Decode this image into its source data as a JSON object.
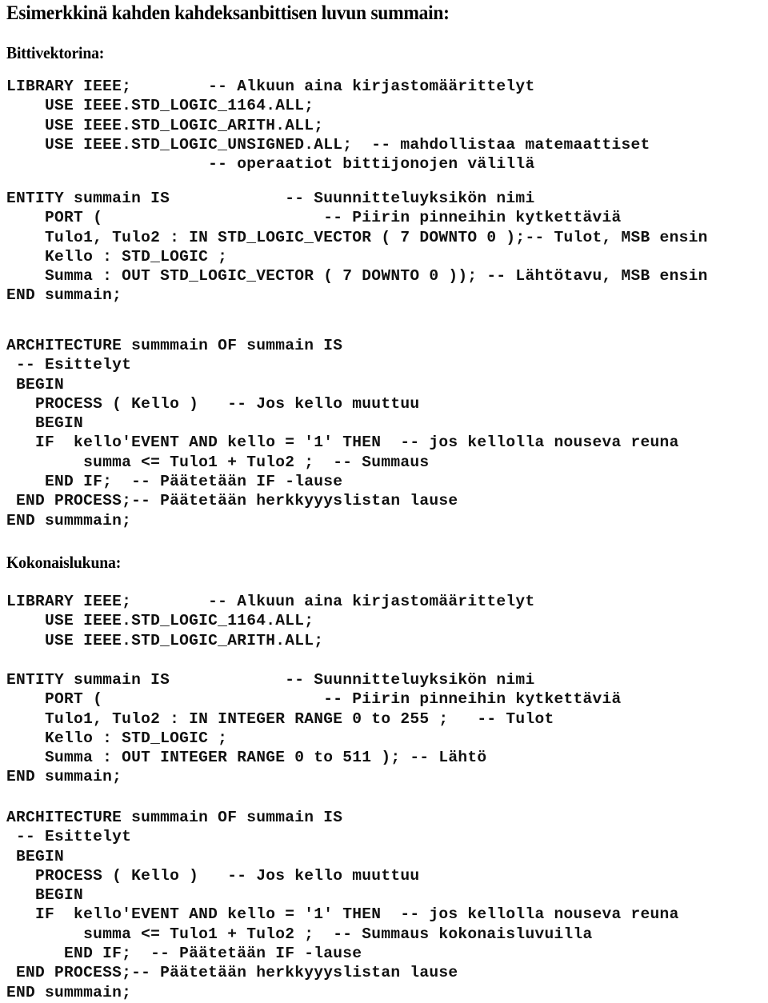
{
  "document": {
    "title": "Esimerkkinä kahden kahdeksanbittisen luvun summain:",
    "section_1_heading": "Bittivektorina:",
    "section_2_heading": "Kokonaislukuna:"
  },
  "code": {
    "block_1_library": "LIBRARY IEEE;        -- Alkuun aina kirjastomäärittelyt\n    USE IEEE.STD_LOGIC_1164.ALL;\n    USE IEEE.STD_LOGIC_ARITH.ALL;\n    USE IEEE.STD_LOGIC_UNSIGNED.ALL;  -- mahdollistaa matemaattiset\n                     -- operaatiot bittijonojen välillä",
    "block_2_entity": "ENTITY summain IS            -- Suunnitteluyksikön nimi\n    PORT (                       -- Piirin pinneihin kytkettäviä\n    Tulo1, Tulo2 : IN STD_LOGIC_VECTOR ( 7 DOWNTO 0 );-- Tulot, MSB ensin\n    Kello : STD_LOGIC ;\n    Summa : OUT STD_LOGIC_VECTOR ( 7 DOWNTO 0 )); -- Lähtötavu, MSB ensin\nEND summain;",
    "block_3_architecture": "ARCHITECTURE summmain OF summain IS\n -- Esittelyt\n BEGIN\n   PROCESS ( Kello )   -- Jos kello muuttuu\n   BEGIN\n   IF  kello'EVENT AND kello = '1' THEN  -- jos kellolla nouseva reuna\n        summa <= Tulo1 + Tulo2 ;  -- Summaus\n    END IF;  -- Päätetään IF -lause\n END PROCESS;-- Päätetään herkkyyyslistan lause\nEND summmain;",
    "block_4_library": "LIBRARY IEEE;        -- Alkuun aina kirjastomäärittelyt\n    USE IEEE.STD_LOGIC_1164.ALL;\n    USE IEEE.STD_LOGIC_ARITH.ALL;",
    "block_5_entity": "ENTITY summain IS            -- Suunnitteluyksikön nimi\n    PORT (                       -- Piirin pinneihin kytkettäviä\n    Tulo1, Tulo2 : IN INTEGER RANGE 0 to 255 ;   -- Tulot\n    Kello : STD_LOGIC ;\n    Summa : OUT INTEGER RANGE 0 to 511 ); -- Lähtö\nEND summain;",
    "block_6_architecture": "ARCHITECTURE summmain OF summain IS\n -- Esittelyt\n BEGIN\n   PROCESS ( Kello )   -- Jos kello muuttuu\n   BEGIN\n   IF  kello'EVENT AND kello = '1' THEN  -- jos kellolla nouseva reuna\n        summa <= Tulo1 + Tulo2 ;  -- Summaus kokonaisluvuilla\n      END IF;  -- Päätetään IF -lause\n END PROCESS;-- Päätetään herkkyyyslistan lause\nEND summmain;"
  },
  "colors": {
    "page_background": "#ffffff",
    "text": "#000000",
    "code_text": "#111111"
  }
}
